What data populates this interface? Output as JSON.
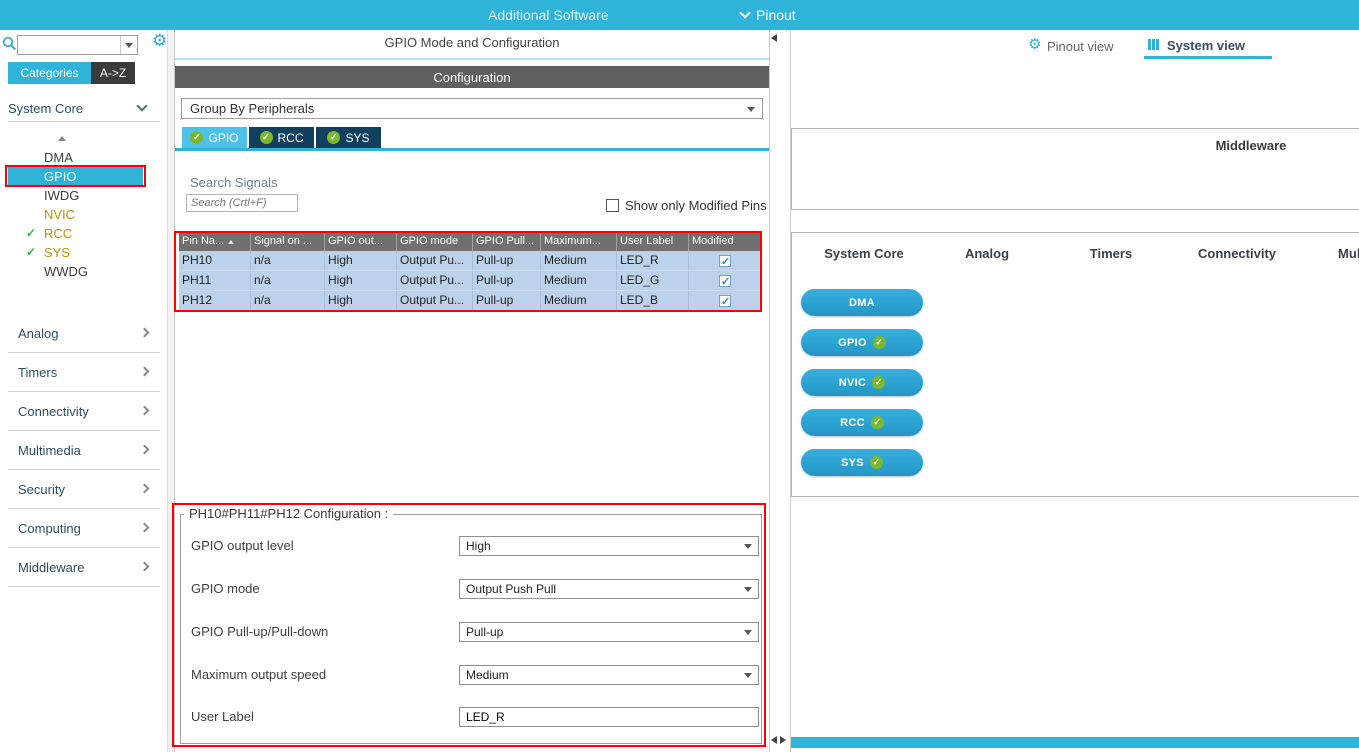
{
  "topbar": {
    "menu_additional_software": "Additional Software",
    "menu_pinout": "Pinout"
  },
  "sidebar": {
    "search_value": "",
    "tab_categories": "Categories",
    "tab_az": "A->Z",
    "system_core_label": "System Core",
    "core_items": [
      "DMA",
      "GPIO",
      "IWDG",
      "NVIC",
      "RCC",
      "SYS",
      "WWDG"
    ],
    "categories": [
      "Analog",
      "Timers",
      "Connectivity",
      "Multimedia",
      "Security",
      "Computing",
      "Middleware"
    ]
  },
  "mode_panel": {
    "title": "GPIO Mode and Configuration",
    "config_header": "Configuration",
    "group_by_value": "Group By Peripherals",
    "tabs": [
      "GPIO",
      "RCC",
      "SYS"
    ],
    "search_signals_label": "Search Signals",
    "search_placeholder": "Search (Crtl+F)",
    "show_only_modified_label": "Show only Modified Pins",
    "table": {
      "headers": [
        "Pin Na...",
        "Signal on ...",
        "GPIO out...",
        "GPIO mode",
        "GPIO Pull...",
        "Maximum...",
        "User Label",
        "Modified"
      ],
      "rows": [
        [
          "PH10",
          "n/a",
          "High",
          "Output Pu...",
          "Pull-up",
          "Medium",
          "LED_R"
        ],
        [
          "PH11",
          "n/a",
          "High",
          "Output Pu...",
          "Pull-up",
          "Medium",
          "LED_G"
        ],
        [
          "PH12",
          "n/a",
          "High",
          "Output Pu...",
          "Pull-up",
          "Medium",
          "LED_B"
        ]
      ],
      "modified_checked": [
        true,
        true,
        true
      ]
    },
    "group_box": {
      "legend": "PH10#PH11#PH12 Configuration :",
      "fields": [
        {
          "label": "GPIO output level",
          "value": "High"
        },
        {
          "label": "GPIO mode",
          "value": "Output Push Pull"
        },
        {
          "label": "GPIO Pull-up/Pull-down",
          "value": "Pull-up"
        },
        {
          "label": "Maximum output speed",
          "value": "Medium"
        },
        {
          "label": "User Label",
          "value": "LED_R"
        }
      ]
    }
  },
  "system_view": {
    "tab_pinout": "Pinout view",
    "tab_system": "System view",
    "middleware_label": "Middleware",
    "column_headers": [
      "System Core",
      "Analog",
      "Timers",
      "Connectivity",
      "Multim"
    ],
    "buttons": [
      {
        "label": "DMA",
        "checked": false
      },
      {
        "label": "GPIO",
        "checked": true
      },
      {
        "label": "NVIC",
        "checked": true
      },
      {
        "label": "RCC",
        "checked": true
      },
      {
        "label": "SYS",
        "checked": true
      }
    ]
  },
  "colors": {
    "accent_cyan": "#2fb3d9",
    "annotation_red": "#ff0000",
    "row_selection": "#bcd2ea",
    "tab_dark": "#11405f",
    "check_green": "#7cb82f"
  }
}
